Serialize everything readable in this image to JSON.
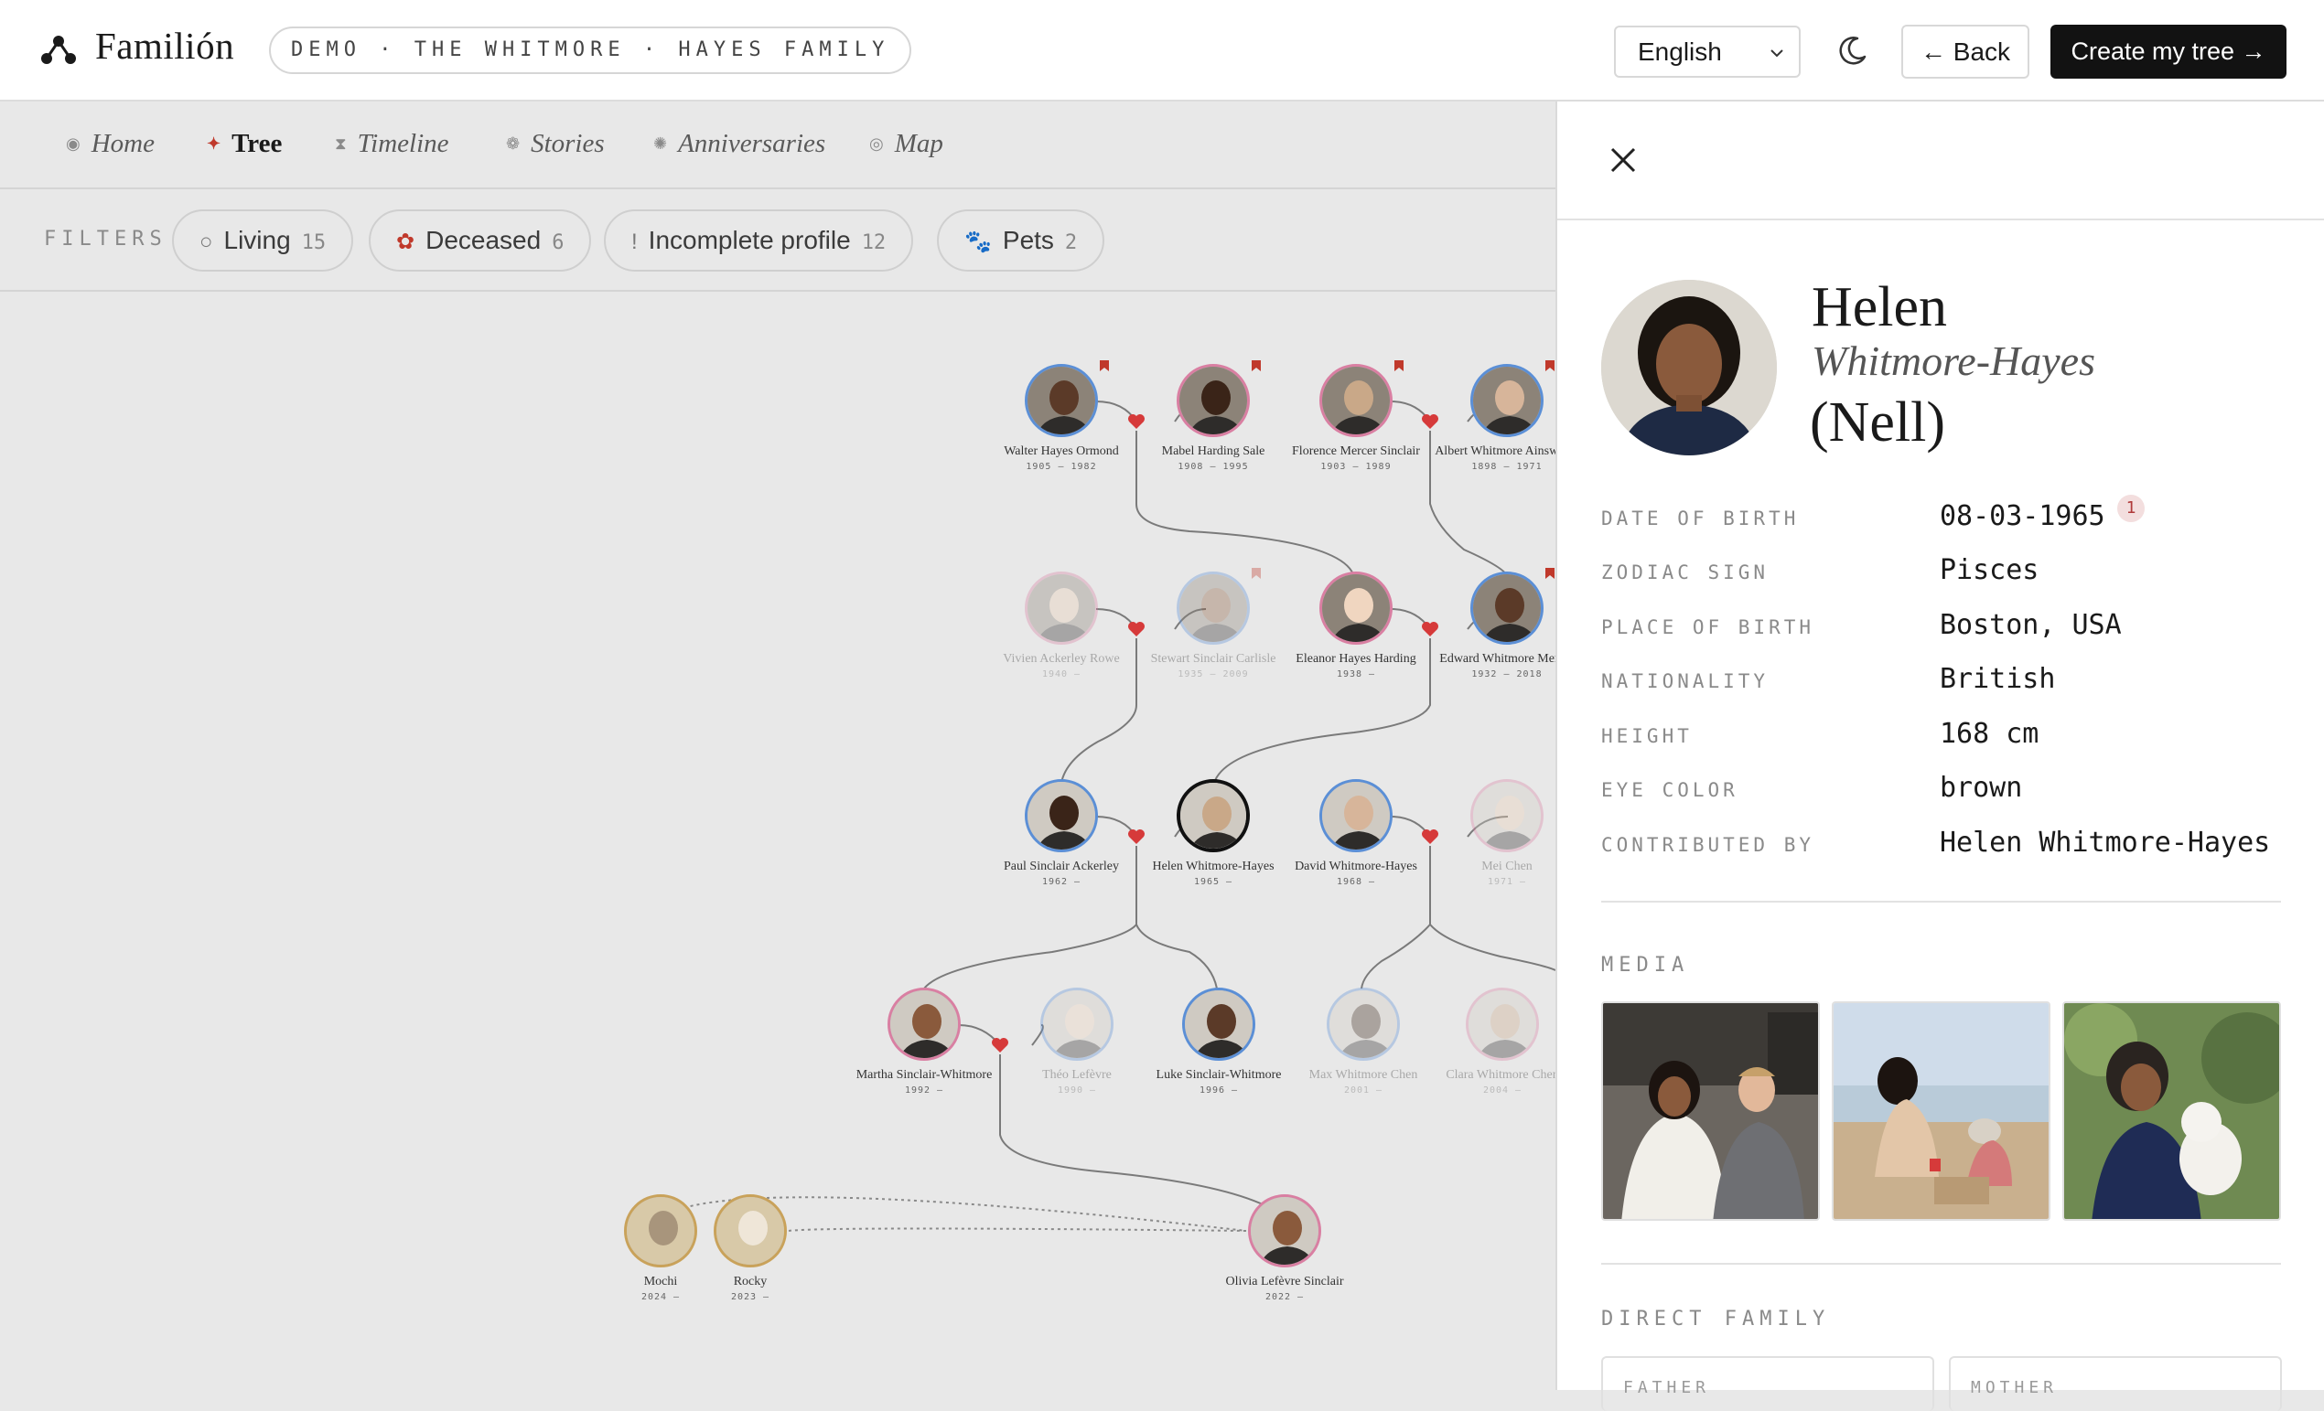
{
  "app": {
    "name": "Familión",
    "demo_label": "DEMO · THE WHITMORE · HAYES FAMILY"
  },
  "header": {
    "language": "English",
    "back_label": "← Back",
    "create_label": "Create my tree →"
  },
  "nav": {
    "items": [
      {
        "label": "Home",
        "icon": "home-icon"
      },
      {
        "label": "Tree",
        "icon": "tree-icon",
        "active": true
      },
      {
        "label": "Timeline",
        "icon": "hourglass-icon"
      },
      {
        "label": "Stories",
        "icon": "stories-icon"
      },
      {
        "label": "Anniversaries",
        "icon": "anniversary-icon"
      },
      {
        "label": "Map",
        "icon": "map-icon"
      }
    ]
  },
  "filters": {
    "label": "FILTERS",
    "chips": [
      {
        "label": "Living",
        "count": "15",
        "icon": "circle-icon"
      },
      {
        "label": "Deceased",
        "count": "6",
        "icon": "rose-icon"
      },
      {
        "label": "Incomplete profile",
        "count": "12",
        "icon": "exclamation-icon"
      },
      {
        "label": "Pets",
        "count": "2",
        "icon": "paw-icon"
      }
    ]
  },
  "tree": {
    "people": [
      {
        "id": "walter",
        "name": "Walter Hayes Ormond",
        "dates": "1905 – 1982",
        "ring": "#5b8fd6",
        "deceased": true
      },
      {
        "id": "mabel",
        "name": "Mabel Harding Sale",
        "dates": "1908 – 1995",
        "ring": "#d97fa2",
        "deceased": true
      },
      {
        "id": "florence",
        "name": "Florence Mercer Sinclair",
        "dates": "1903 – 1989",
        "ring": "#d97fa2",
        "deceased": true
      },
      {
        "id": "albert",
        "name": "Albert Whitmore Ainsworth",
        "dates": "1898 – 1971",
        "ring": "#5b8fd6",
        "deceased": true
      },
      {
        "id": "vivien",
        "name": "Vivien Ackerley Rowe",
        "dates": "1940 –",
        "ring": "#d97fa2",
        "faded": true
      },
      {
        "id": "stewart",
        "name": "Stewart Sinclair Carlisle",
        "dates": "1935 – 2009",
        "ring": "#5b8fd6",
        "faded": true,
        "deceased": true
      },
      {
        "id": "eleanor",
        "name": "Eleanor Hayes Harding",
        "dates": "1938 –",
        "ring": "#d97fa2"
      },
      {
        "id": "edward",
        "name": "Edward Whitmore Mercer",
        "dates": "1932 – 2018",
        "ring": "#5b8fd6",
        "deceased": true
      },
      {
        "id": "paul",
        "name": "Paul Sinclair Ackerley",
        "dates": "1962 –",
        "ring": "#5b8fd6"
      },
      {
        "id": "helen",
        "name": "Helen Whitmore-Hayes",
        "dates": "1965 –",
        "ring": "#111111",
        "selected": true
      },
      {
        "id": "david",
        "name": "David Whitmore-Hayes",
        "dates": "1968 –",
        "ring": "#5b8fd6"
      },
      {
        "id": "mei",
        "name": "Mei Chen",
        "dates": "1971 –",
        "ring": "#d97fa2",
        "faded": true
      },
      {
        "id": "martha",
        "name": "Martha Sinclair-Whitmore",
        "dates": "1992 –",
        "ring": "#d97fa2"
      },
      {
        "id": "theo",
        "name": "Théo Lefèvre",
        "dates": "1990 –",
        "ring": "#5b8fd6",
        "faded": true
      },
      {
        "id": "luke",
        "name": "Luke Sinclair-Whitmore",
        "dates": "1996 –",
        "ring": "#5b8fd6"
      },
      {
        "id": "max",
        "name": "Max Whitmore Chen",
        "dates": "2001 –",
        "ring": "#5b8fd6",
        "faded": true
      },
      {
        "id": "clara",
        "name": "Clara Whitmore Chen",
        "dates": "2004 –",
        "ring": "#d97fa2",
        "faded": true
      },
      {
        "id": "mochi",
        "name": "Mochi",
        "dates": "2024 –",
        "ring": "#c9a25a"
      },
      {
        "id": "rocky",
        "name": "Rocky",
        "dates": "2023 –",
        "ring": "#c9a25a"
      },
      {
        "id": "olivia",
        "name": "Olivia Lefèvre Sinclair",
        "dates": "2022 –",
        "ring": "#d97fa2"
      }
    ]
  },
  "profile": {
    "first_name": "Helen",
    "last_name": "Whitmore-Hayes",
    "nickname": "(Nell)",
    "fields": [
      {
        "label": "DATE OF BIRTH",
        "value": "08-03-1965"
      },
      {
        "label": "ZODIAC SIGN",
        "value": "Pisces"
      },
      {
        "label": "PLACE OF BIRTH",
        "value": "Boston, USA"
      },
      {
        "label": "NATIONALITY",
        "value": "British"
      },
      {
        "label": "HEIGHT",
        "value": "168 cm"
      },
      {
        "label": "EYE COLOR",
        "value": "brown"
      },
      {
        "label": "CONTRIBUTED BY",
        "value": "Helen Whitmore-Hayes"
      }
    ],
    "dob_badge": "1",
    "media_label": "MEDIA",
    "family_label": "DIRECT FAMILY",
    "family_cards": [
      {
        "label": "FATHER"
      },
      {
        "label": "MOTHER"
      }
    ]
  },
  "colors": {
    "male_ring": "#5b8fd6",
    "female_ring": "#d97fa2",
    "pet_ring": "#c9a25a",
    "heart": "#d63a3a",
    "primary_button": "#121212"
  }
}
